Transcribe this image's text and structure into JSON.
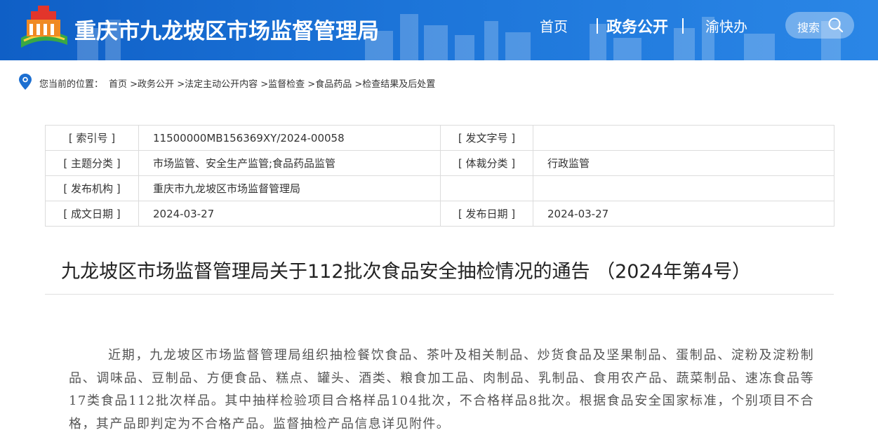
{
  "header": {
    "site_title": "重庆市九龙坡区市场监督管理局",
    "nav": {
      "home": "首页",
      "gov_affairs": "政务公开",
      "yukuaiban": "渝快办"
    },
    "search_label": "搜索",
    "logo_icon": "city-emblem-logo-icon"
  },
  "breadcrumb": {
    "prefix": "您当前的位置：",
    "items": [
      "首页",
      ">政务公开",
      ">法定主动公开内容",
      ">监督检查",
      ">食品药品",
      ">检查结果及后处置"
    ]
  },
  "meta": {
    "index_no_label": "[ 索引号 ]",
    "index_no_value": "11500000MB156369XY/2024-00058",
    "doc_no_label": "[ 发文字号 ]",
    "doc_no_value": "",
    "topic_label": "[ 主题分类 ]",
    "topic_value": "市场监管、安全生产监管;食品药品监管",
    "genre_label": "[ 体裁分类 ]",
    "genre_value": "行政监管",
    "publisher_label": "[ 发布机构 ]",
    "publisher_value": "重庆市九龙坡区市场监督管理局",
    "created_label": "[ 成文日期 ]",
    "created_value": "2024-03-27",
    "published_label": "[ 发布日期 ]",
    "published_value": "2024-03-27"
  },
  "doc": {
    "title": "九龙坡区市场监督管理局关于112批次食品安全抽检情况的通告 （2024年第4号）",
    "body": "近期，九龙坡区市场监督管理局组织抽检餐饮食品、茶叶及相关制品、炒货食品及坚果制品、蛋制品、淀粉及淀粉制品、调味品、豆制品、方便食品、糕点、罐头、酒类、粮食加工品、肉制品、乳制品、食用农产品、蔬菜制品、速冻食品等17类食品112批次样品。其中抽样检验项目合格样品104批次，不合格样品8批次。根据食品安全国家标准，个别项目不合格，其产品即判定为不合格产品。监督抽检产品信息详见附件。"
  },
  "colors": {
    "header_blue": "#1c74d8",
    "text": "#333333"
  }
}
